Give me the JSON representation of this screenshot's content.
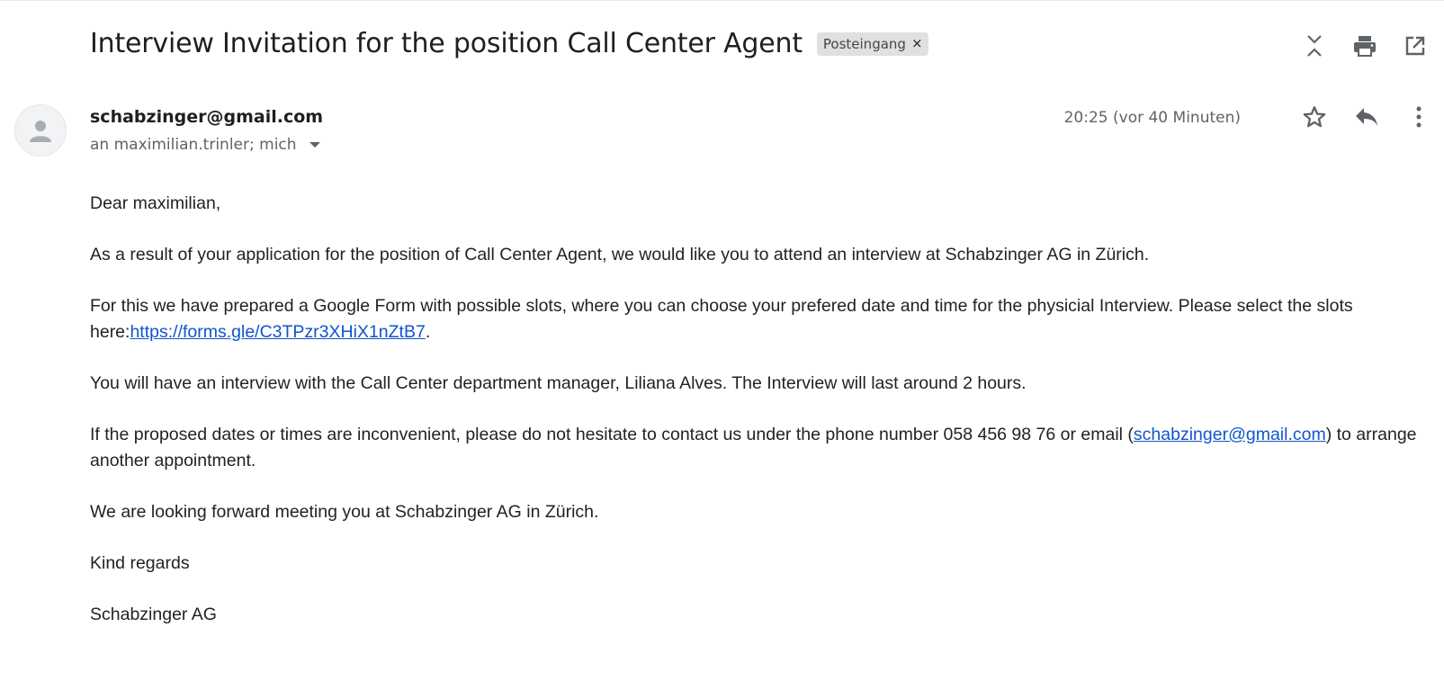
{
  "header": {
    "subject": "Interview Invitation for the position Call Center Agent",
    "label_chip": "Posteingang",
    "chip_close": "×"
  },
  "message": {
    "sender": "schabzinger@gmail.com",
    "recipients": "an maximilian.trinler; mich",
    "date": "20:25 (vor 40 Minuten)"
  },
  "body": {
    "greeting": "Dear maximilian,",
    "p1": "As a result of your application for the position of Call Center Agent, we would like you to attend an interview at Schabzinger AG in Zürich.",
    "p2_before": "For this we have prepared a Google Form with possible slots, where you can choose your prefered date and time for the physicial Interview. Please select the slots here:",
    "p2_link": "https://forms.gle/C3TPzr3XHiX1nZtB7",
    "p2_after": ".",
    "p3": "You will have an interview with the Call Center department manager, Liliana Alves. The Interview will last around 2 hours.",
    "p4_before": "If the proposed dates or times are inconvenient, please do not hesitate to contact us under the phone number 058 456 98 76 or email (",
    "p4_link": "schabzinger@gmail.com",
    "p4_after": ") to arrange another appointment.",
    "p5": "We are looking forward meeting you at Schabzinger AG in Zürich.",
    "closing": "Kind regards",
    "signature": "Schabzinger AG"
  },
  "icons": {
    "collapse": "collapse-all-icon",
    "print": "print-icon",
    "open_new_window": "open-in-new-window-icon",
    "star": "star-icon",
    "reply": "reply-icon",
    "more": "more-vert-icon",
    "avatar": "person-icon"
  },
  "colors": {
    "link": "#1155cc",
    "chip_bg": "#e0e0e0",
    "icon": "#5f6368"
  }
}
